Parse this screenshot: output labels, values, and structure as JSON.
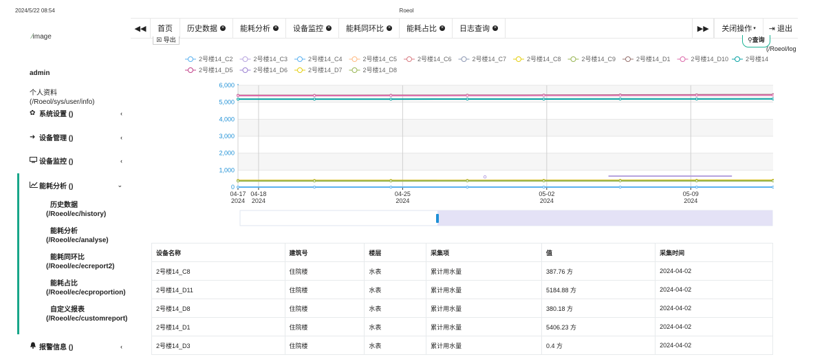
{
  "print_header": {
    "datetime": "2024/5/22 08:54",
    "title": "Roeol"
  },
  "sidebar": {
    "logo_text": "image",
    "logo_icon": "broken-image-icon",
    "username": "admin",
    "profile_label": "个人资料",
    "profile_path": "(/Roeol/sys/user/info)",
    "menus": [
      {
        "label": "系统设置 ()",
        "icon": "gear-icon"
      },
      {
        "label": "设备管理 ()",
        "icon": "arrow-right-icon"
      },
      {
        "label": "设备监控 ()",
        "icon": "monitor-icon"
      },
      {
        "label": "能耗分析 ()",
        "icon": "chart-line-icon",
        "expanded": true
      },
      {
        "label": "报警信息 ()",
        "icon": "bell-icon"
      }
    ],
    "submenu": [
      {
        "label": "历史数据",
        "path": "(/Roeol/ec/history)"
      },
      {
        "label": "能耗分析",
        "path": "(/Roeol/ec/analyse)"
      },
      {
        "label": "能耗同环比",
        "path": "(/Roeol/ec/ecreport2)"
      },
      {
        "label": "能耗占比",
        "path": "(/Roeol/ec/ecproportion)"
      },
      {
        "label": "自定义报表",
        "path": "(/Roeol/ec/customreport)"
      }
    ]
  },
  "topnav": {
    "home": "首页",
    "tabs": [
      "历史数据",
      "能耗分析",
      "设备监控",
      "能耗同环比",
      "能耗占比",
      "日志查询"
    ],
    "close_menu": "关闭操作",
    "exit": "退出"
  },
  "toolbar": {
    "export_label": "导出",
    "query_label": "查询",
    "path_note": "(/Roeol/log"
  },
  "chart_data": {
    "type": "line",
    "x": [
      "2024-04-17",
      "2024-05-13"
    ],
    "x_ticks": [
      [
        "04-17",
        "2024"
      ],
      [
        "04-18",
        "2024"
      ],
      [
        "04-25",
        "2024"
      ],
      [
        "05-02",
        "2024"
      ],
      [
        "05-09",
        "2024"
      ]
    ],
    "ylim": [
      0,
      6000
    ],
    "y_ticks": [
      "0",
      "1,000",
      "2,000",
      "3,000",
      "4,000",
      "5,000",
      "6,000"
    ],
    "grid": true,
    "legend_position": "top",
    "legend": [
      "2号楼14_C2",
      "2号楼14_C3",
      "2号楼14_C4",
      "2号楼14_C5",
      "2号楼14_C6",
      "2号楼14_C7",
      "2号楼14_C8",
      "2号楼14_C9",
      "2号楼14_D1",
      "2号楼14_D10",
      "2号楼14",
      "2号楼14_D5",
      "2号楼14_D6",
      "2号楼14_D7",
      "2号楼14_D8"
    ],
    "legend_colors": [
      "#5ab1ef",
      "#b6a2de",
      "#5ab1ef",
      "#ffb980",
      "#d87a80",
      "#8d98b3",
      "#e5cf0d",
      "#97b552",
      "#95706d",
      "#dc69aa",
      "#07a2a4",
      "#c14089",
      "#9a7fd1",
      "#e5cf0d",
      "#97b552"
    ],
    "series": [
      {
        "name": "2号楼14_D1",
        "color": "#95706d",
        "values": [
          5406,
          5406,
          5410,
          5415,
          5420,
          5430,
          5440,
          5450
        ]
      },
      {
        "name": "2号楼14_D10",
        "color": "#dc69aa",
        "values": [
          5390,
          5392,
          5395,
          5400,
          5405,
          5410,
          5415,
          5420
        ]
      },
      {
        "name": "2号楼14",
        "color": "#07a2a4",
        "values": [
          5184,
          5185,
          5186,
          5188,
          5190,
          5192,
          5195,
          5198
        ]
      },
      {
        "name": "2号楼14_C8",
        "color": "#e5cf0d",
        "values": [
          388,
          389,
          390,
          392,
          394,
          396,
          398,
          400
        ]
      },
      {
        "name": "2号楼14_D7",
        "color": "#c8a400",
        "values": [
          380,
          381,
          382,
          383,
          384,
          385,
          386,
          387
        ]
      },
      {
        "name": "2号楼14_D8",
        "color": "#97b552",
        "values": [
          360,
          361,
          362,
          363,
          364,
          365,
          366,
          367
        ]
      },
      {
        "name": "2号楼14_C2",
        "color": "#5ab1ef",
        "values": [
          0,
          0,
          0,
          0,
          0,
          0,
          0,
          0
        ]
      }
    ],
    "segments": [
      {
        "name": "2号楼14_C7",
        "color": "#b6a2de",
        "from": "2024-05-05",
        "to": "2024-05-11",
        "value": 650
      },
      {
        "name": "2号楼14_C3",
        "color": "#b6a2de",
        "from": "2024-04-29",
        "to": "2024-04-29",
        "value": 600
      }
    ]
  },
  "table": {
    "headers": [
      "设备名称",
      "建筑号",
      "楼层",
      "采集项",
      "值",
      "采集时间"
    ],
    "rows": [
      [
        "2号楼14_C8",
        "住院楼",
        "水表",
        "累计用水量",
        "387.76 方",
        "2024-04-02"
      ],
      [
        "2号楼14_D11",
        "住院楼",
        "水表",
        "累计用水量",
        "5184.88 方",
        "2024-04-02"
      ],
      [
        "2号楼14_D8",
        "住院楼",
        "水表",
        "累计用水量",
        "380.18 方",
        "2024-04-02"
      ],
      [
        "2号楼14_D1",
        "住院楼",
        "水表",
        "累计用水量",
        "5406.23 方",
        "2024-04-02"
      ],
      [
        "2号楼14_D3",
        "住院楼",
        "水表",
        "累计用水量",
        "0.4 方",
        "2024-04-02"
      ]
    ]
  }
}
